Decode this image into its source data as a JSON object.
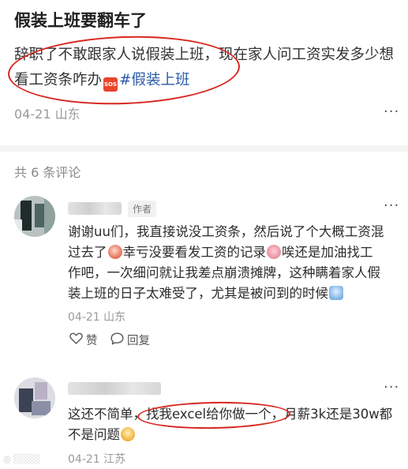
{
  "post": {
    "title": "假装上班要翻车了",
    "body_text": "辞职了不敢跟家人说假装上班，现在家人问工资实发多少想看工资条咋办",
    "sos_label": "SOS",
    "hashtag": "#假装上班",
    "date": "04-21",
    "location": "山东"
  },
  "comments_header": {
    "label": "共 6 条评论"
  },
  "comments": [
    {
      "author_badge": "作者",
      "text_1": "谢谢uu们，我直接说没工资条，然后说了个大概工资混过去了",
      "text_2": "幸亏没要看发工资的记录",
      "text_3": "唉还是加油找工作吧，一次细问就让我差点崩溃摊牌，这种瞒着家人假装上班的日子太难受了，尤其是被问到的时候",
      "date": "04-21",
      "location": "山东",
      "like_label": "赞",
      "reply_label": "回复"
    },
    {
      "text": "这还不简单，找我excel给你做一个，月薪3k还是30w都不是问题",
      "date": "04-21",
      "location": "江苏"
    }
  ],
  "icons": {
    "more": "more-icon",
    "like": "heart-outline-icon",
    "reply": "speech-bubble-icon"
  },
  "colors": {
    "annotation": "#d8261f",
    "hashtag": "#2a5aa8",
    "sos": "#e8452c"
  }
}
